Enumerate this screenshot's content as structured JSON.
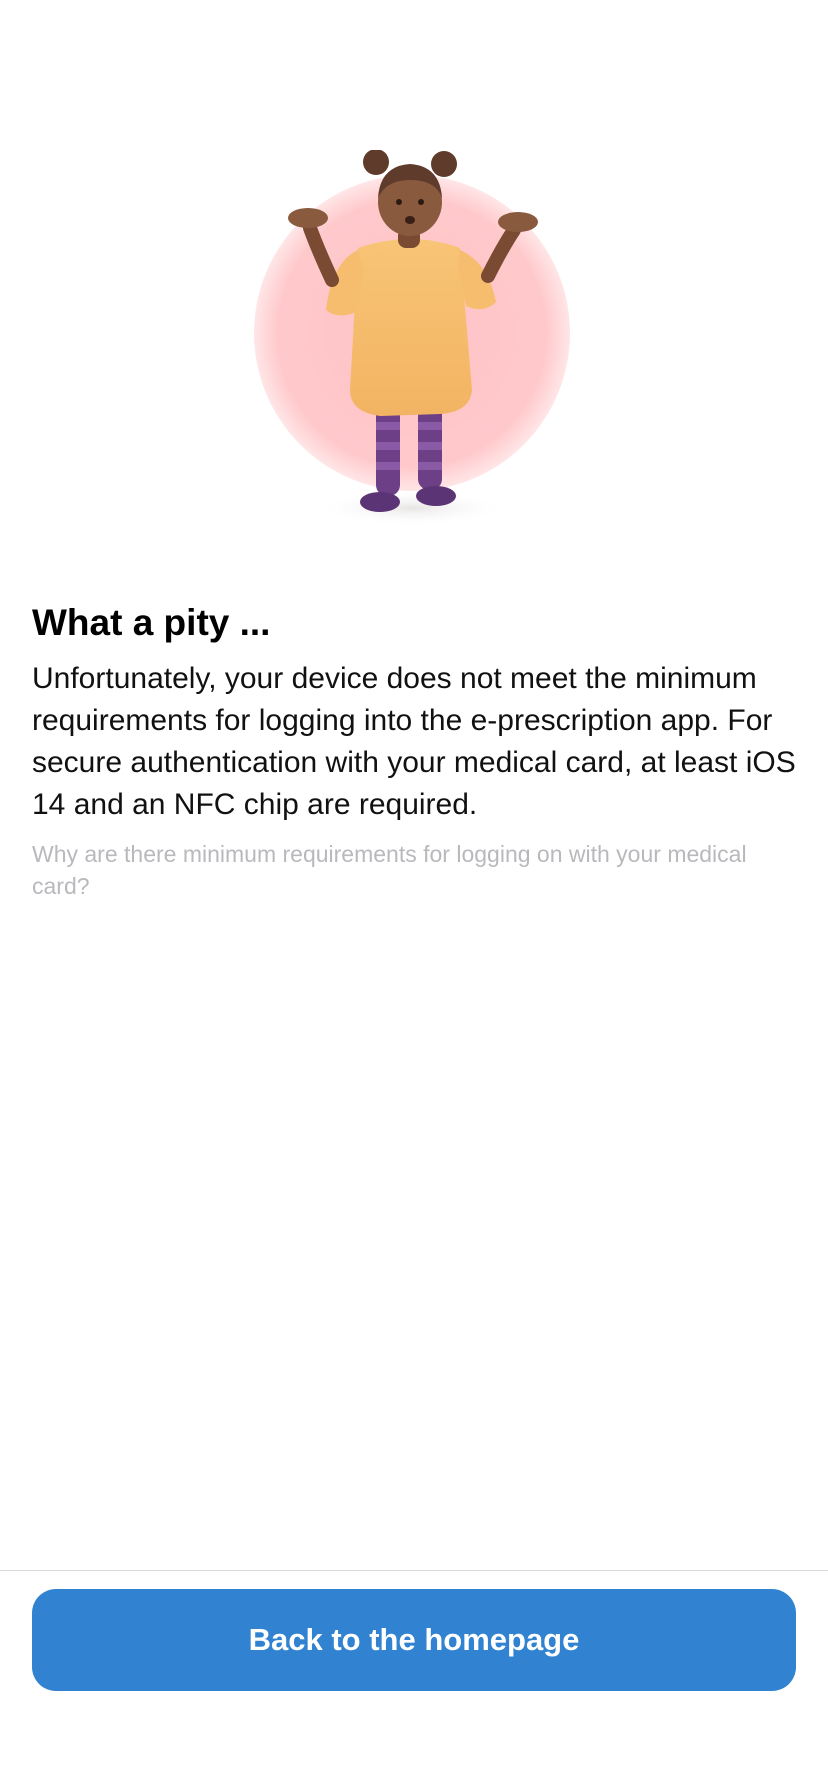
{
  "illustration": {
    "icon": "shrugging-girl-illustration",
    "circle_color": "#ffc9cc"
  },
  "main": {
    "title": "What a pity ...",
    "body": "Unfortunately, your device does not meet the minimum requirements for logging into the e-prescription app. For secure authentication with your medical card, at least iOS 14 and an NFC chip are required.",
    "info_link": "Why are there minimum requirements for logging on with your medical card?"
  },
  "footer": {
    "button_label": "Back to the homepage",
    "button_color": "#3183d1"
  }
}
